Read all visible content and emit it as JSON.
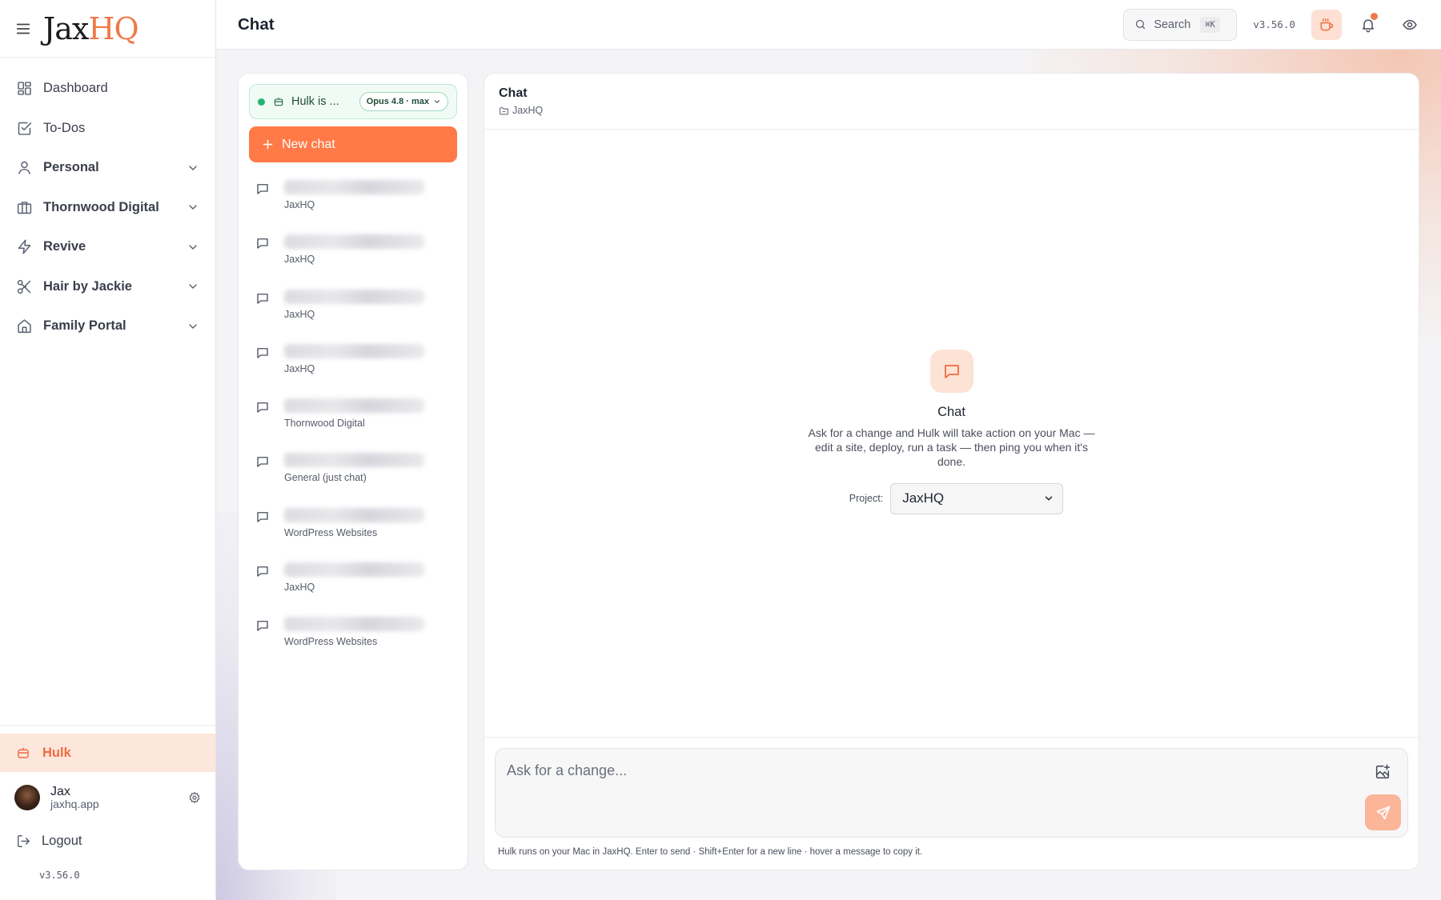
{
  "brand": {
    "logo_main": "Jax",
    "logo_accent": "HQ"
  },
  "sidebar": {
    "items": [
      {
        "label": "Dashboard",
        "icon": "dashboard-icon"
      },
      {
        "label": "To-Dos",
        "icon": "checkbox-icon"
      },
      {
        "label": "Personal",
        "icon": "user-icon",
        "expandable": true
      },
      {
        "label": "Thornwood Digital",
        "icon": "briefcase-icon",
        "expandable": true
      },
      {
        "label": "Revive",
        "icon": "zap-icon",
        "expandable": true
      },
      {
        "label": "Hair by Jackie",
        "icon": "scissors-icon",
        "expandable": true
      },
      {
        "label": "Family Portal",
        "icon": "home-icon",
        "expandable": true
      }
    ],
    "active_item": {
      "label": "Hulk",
      "icon": "robot-icon"
    },
    "user": {
      "name": "Jax",
      "domain": "jaxhq.app"
    },
    "logout_label": "Logout",
    "version": "v3.56.0"
  },
  "topbar": {
    "title": "Chat",
    "search_label": "Search",
    "search_shortcut": "⌘K",
    "version": "v3.56.0",
    "notifications_unread": true
  },
  "chat_list": {
    "status_text": "Hulk is ...",
    "model_label": "Opus 4.8 · max",
    "new_chat_label": "New chat",
    "items": [
      {
        "project": "JaxHQ"
      },
      {
        "project": "JaxHQ"
      },
      {
        "project": "JaxHQ"
      },
      {
        "project": "JaxHQ"
      },
      {
        "project": "Thornwood Digital"
      },
      {
        "project": "General (just chat)"
      },
      {
        "project": "WordPress Websites"
      },
      {
        "project": "JaxHQ"
      },
      {
        "project": "WordPress Websites"
      }
    ]
  },
  "chat": {
    "header_title": "Chat",
    "header_project": "JaxHQ",
    "empty_title": "Chat",
    "empty_description": "Ask for a change and Hulk will take action on your Mac — edit a site, deploy, run a task — then ping you when it's done.",
    "project_label": "Project:",
    "project_value": "JaxHQ",
    "composer_placeholder": "Ask for a change...",
    "hint": "Hulk runs on your Mac in JaxHQ. Enter to send · Shift+Enter for a new line · hover a message to copy it."
  },
  "colors": {
    "accent": "#ff7a47",
    "status_green": "#22b573",
    "accent_soft": "#fde6dc"
  }
}
